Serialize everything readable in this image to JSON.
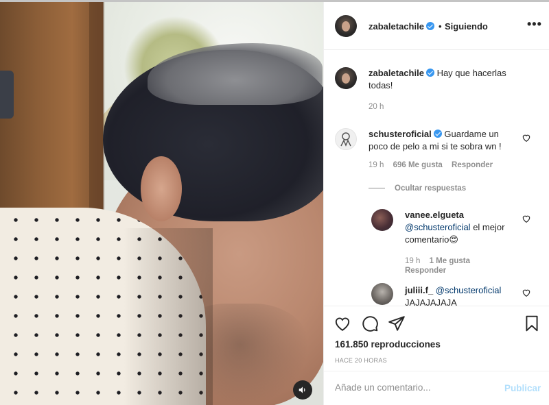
{
  "post": {
    "author": "zabaletachile",
    "follow_status": "Siguiendo",
    "separator": "•",
    "more_label": "•••"
  },
  "caption": {
    "username": "zabaletachile",
    "text": "Hay que hacerlas todas!",
    "time": "20 h"
  },
  "comments": [
    {
      "username": "schusteroficial",
      "verified": true,
      "text": "Guardame un poco de pelo a mi si te sobra wn !",
      "time": "19 h",
      "likes": "696 Me gusta",
      "reply": "Responder",
      "hide_replies": "Ocultar respuestas",
      "replies": [
        {
          "username": "vanee.elgueta",
          "mention": "@schusteroficial",
          "text": "el mejor comentario",
          "emoji": "😍",
          "time": "19 h",
          "likes": "1 Me gusta",
          "reply": "Responder"
        },
        {
          "username": "juliii.f_",
          "mention": "@schusteroficial",
          "text": "JAJAJAJAJA"
        }
      ]
    }
  ],
  "stats": {
    "views": "161.850 reproducciones",
    "time_ago": "HACE 20 HORAS"
  },
  "add_comment": {
    "placeholder": "Añade un comentario...",
    "publish": "Publicar"
  },
  "icons": {
    "like": "heart-icon",
    "comment": "comment-icon",
    "share": "paper-plane-icon",
    "save": "bookmark-icon",
    "sound": "speaker-icon"
  },
  "colors": {
    "verified": "#3897f0",
    "publish_disabled": "#b2dffc",
    "mention": "#00376b",
    "muted": "#8e8e8e"
  }
}
